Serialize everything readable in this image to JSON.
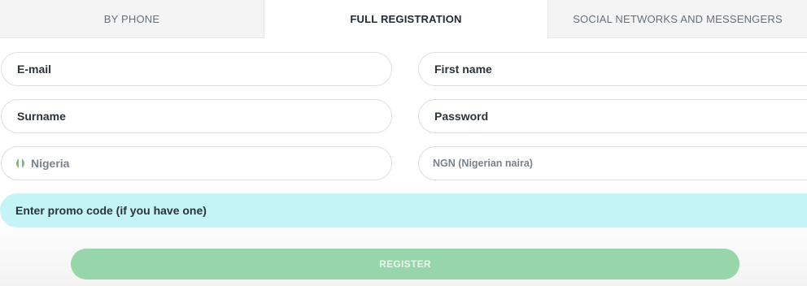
{
  "tabs": [
    {
      "label": "BY PHONE",
      "active": false
    },
    {
      "label": "FULL REGISTRATION",
      "active": true
    },
    {
      "label": "SOCIAL NETWORKS AND MESSENGERS",
      "active": false
    }
  ],
  "form": {
    "email_placeholder": "E-mail",
    "first_name_placeholder": "First name",
    "surname_placeholder": "Surname",
    "password_placeholder": "Password",
    "country_value": "Nigeria",
    "country_flag_icon": "nigeria-flag-icon",
    "currency_value": "NGN (Nigerian naira)",
    "promo_placeholder": "Enter promo code (if you have one)",
    "register_label": "REGISTER"
  },
  "colors": {
    "promo_background": "#c4f4f5",
    "register_button": "#96d6aa",
    "field_border": "#dcdfe3"
  }
}
